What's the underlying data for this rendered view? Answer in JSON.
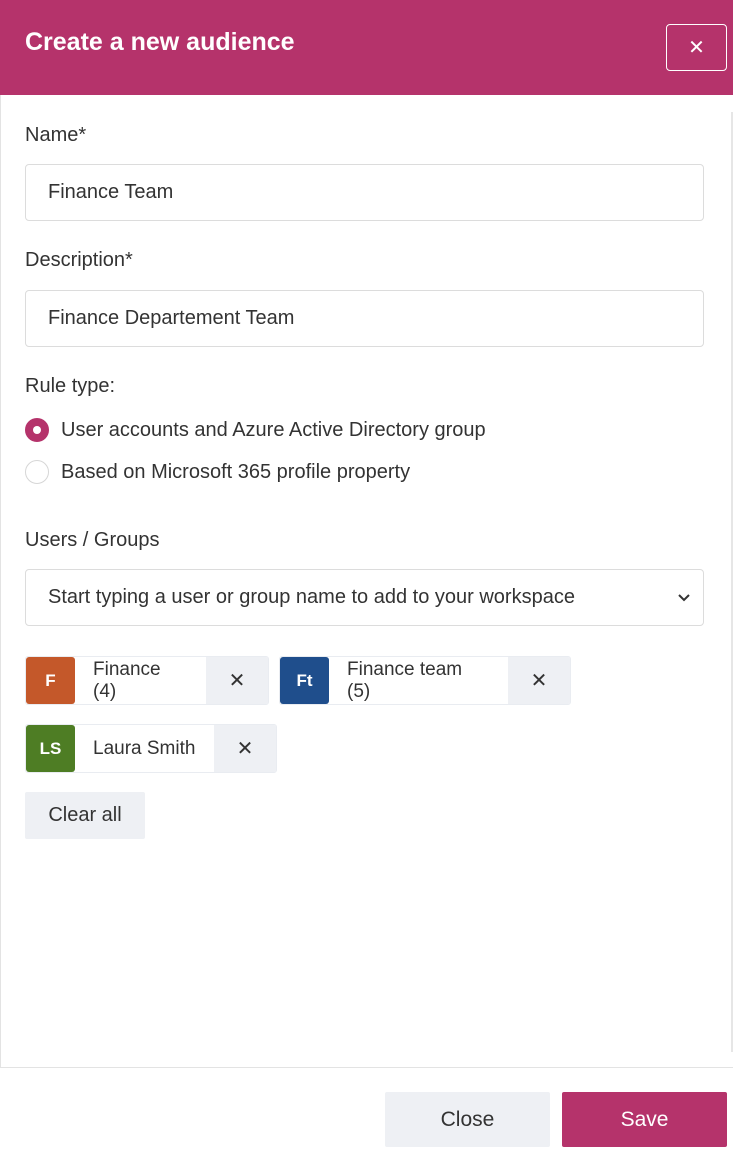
{
  "dialog": {
    "title": "Create a new audience",
    "close_glyph": "✕"
  },
  "form": {
    "name_label": "Name*",
    "name_value": "Finance Team",
    "description_label": "Description*",
    "description_value": "Finance Departement Team",
    "rule_type_label": "Rule type:",
    "rule_options": [
      {
        "label": "User accounts and Azure Active Directory group",
        "selected": true
      },
      {
        "label": "Based on Microsoft 365 profile property",
        "selected": false
      }
    ],
    "users_groups_label": "Users / Groups",
    "users_groups_placeholder": "Start typing a user or group name to add to your workspace"
  },
  "chips": [
    {
      "initials": "F",
      "label": "Finance (4)",
      "color": "#c4582a",
      "remove_glyph": "✕"
    },
    {
      "initials": "Ft",
      "label": "Finance team (5)",
      "color": "#1f4e8c",
      "remove_glyph": "✕"
    },
    {
      "initials": "LS",
      "label": "Laura Smith",
      "color": "#4e7d24",
      "remove_glyph": "✕"
    }
  ],
  "actions": {
    "clear_all": "Clear all",
    "close": "Close",
    "save": "Save"
  },
  "colors": {
    "accent": "#b5336b"
  }
}
